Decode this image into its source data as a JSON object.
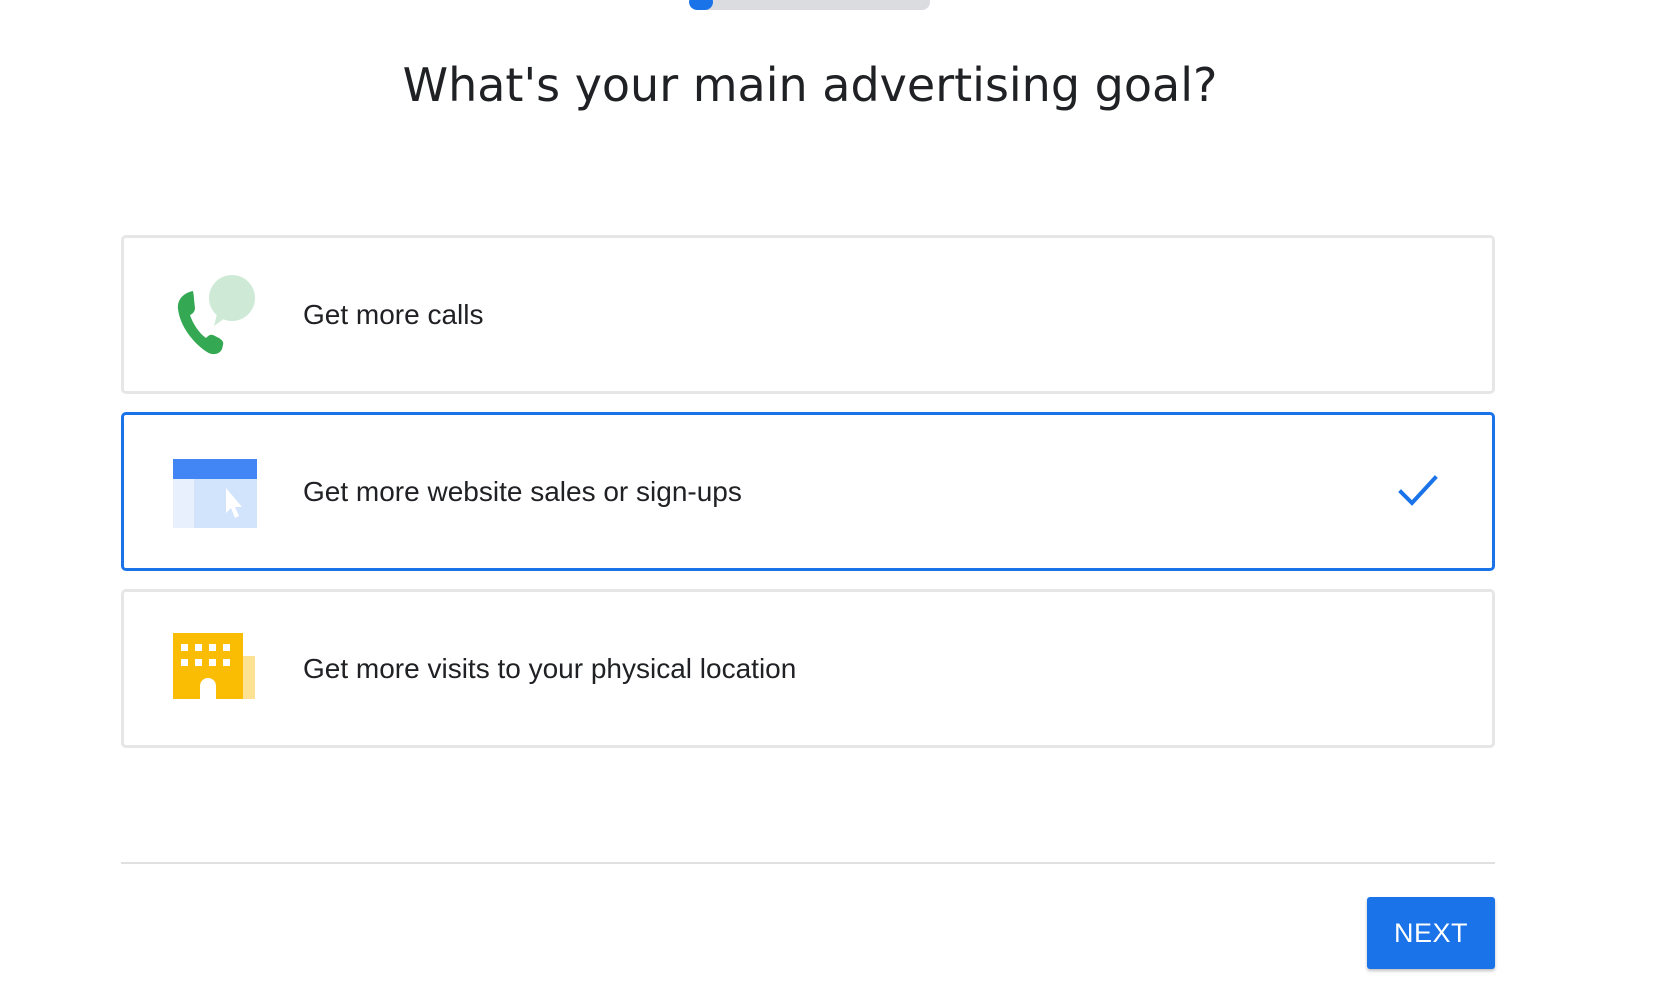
{
  "progress": {
    "fraction": 0.1
  },
  "page": {
    "title": "What's your main advertising goal?"
  },
  "options": [
    {
      "label": "Get more calls",
      "icon": "phone-call-icon",
      "selected": false
    },
    {
      "label": "Get more website sales or sign-ups",
      "icon": "website-click-icon",
      "selected": true
    },
    {
      "label": "Get more visits to your physical location",
      "icon": "building-icon",
      "selected": false
    }
  ],
  "footer": {
    "next_label": "NEXT"
  },
  "colors": {
    "accent": "#1a73e8",
    "card_border": "#e6e6e6",
    "phone_green": "#34a853",
    "bubble_green": "#ceead6",
    "building_yellow": "#fbbc04",
    "building_light": "#fde293",
    "web_blue": "#4285f4",
    "web_light": "#d2e3fc"
  }
}
